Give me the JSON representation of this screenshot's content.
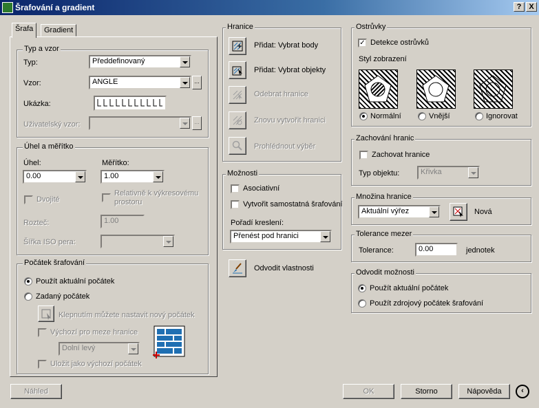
{
  "window": {
    "title": "Šrafování a gradient",
    "help_btn": "?",
    "close_btn": "X"
  },
  "tabs": [
    "Šrafa",
    "Gradient"
  ],
  "type_pattern": {
    "legend": "Typ a vzor",
    "type_label": "Typ:",
    "type_value": "Předdefinovaný",
    "pattern_label": "Vzor:",
    "pattern_value": "ANGLE",
    "more": "...",
    "sample_label": "Ukázka:",
    "custom_label": "Uživatelský vzor:"
  },
  "angle_scale": {
    "legend": "Úhel a měřítko",
    "angle_label": "Úhel:",
    "angle_value": "0.00",
    "scale_label": "Měřítko:",
    "scale_value": "1.00",
    "double": "Dvojité",
    "relative": "Relativně k výkresovému prostoru",
    "spacing_label": "Rozteč:",
    "spacing_value": "1.00",
    "iso_label": "Šířka ISO pera:"
  },
  "origin": {
    "legend": "Počátek šrafování",
    "use_current": "Použít aktuální počátek",
    "specified": "Zadaný počátek",
    "click_set": "Klepnutím můžete nastavit nový počátek",
    "default_bounds": "Výchozí pro meze hranice",
    "bottom_left": "Dolní levý",
    "save_default": "Uložit jako výchozí počátek"
  },
  "boundaries": {
    "legend": "Hranice",
    "add_points": "Přidat: Vybrat body",
    "add_objects": "Přidat: Vybrat objekty",
    "remove": "Odebrat hranice",
    "recreate": "Znovu vytvořit hranici",
    "view": "Prohlédnout výběr"
  },
  "options": {
    "legend": "Možnosti",
    "associative": "Asociativní",
    "separate": "Vytvořit samostatná šrafování",
    "draw_order_label": "Pořadí kreslení:",
    "draw_order_value": "Přenést pod hranici"
  },
  "inherit": {
    "label": "Odvodit vlastnosti"
  },
  "islands": {
    "legend": "Ostrůvky",
    "detect": "Detekce ostrůvků",
    "style_label": "Styl zobrazení",
    "normal": "Normální",
    "outer": "Vnější",
    "ignore": "Ignorovat"
  },
  "retain": {
    "legend": "Zachování hranic",
    "retain_label": "Zachovat hranice",
    "obj_type_label": "Typ objektu:",
    "obj_type_value": "Křivka"
  },
  "boundary_set": {
    "legend": "Množina hranice",
    "value": "Aktuální výřez",
    "new_label": "Nová"
  },
  "gap": {
    "legend": "Tolerance mezer",
    "tol_label": "Tolerance:",
    "tol_value": "0.00",
    "unit": "jednotek"
  },
  "inherit_opts": {
    "legend": "Odvodit možnosti",
    "use_current": "Použít aktuální počátek",
    "use_source": "Použít zdrojový počátek šrafování"
  },
  "footer": {
    "preview": "Náhled",
    "ok": "OK",
    "cancel": "Storno",
    "help": "Nápověda"
  }
}
